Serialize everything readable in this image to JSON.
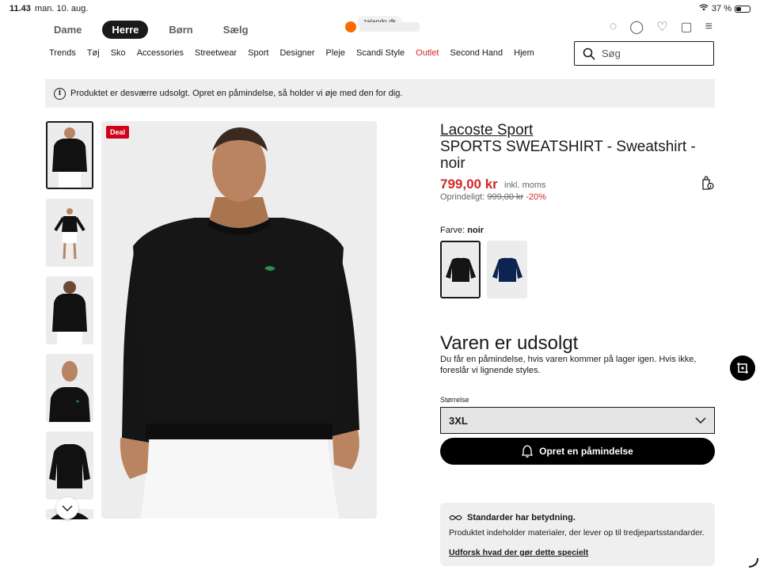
{
  "status": {
    "time": "11.43",
    "date": "man. 10. aug.",
    "battery": "37 %",
    "battery_level": 0.37
  },
  "browser": {
    "url": "zalando.dk"
  },
  "topnav": {
    "tabs": [
      "Dame",
      "Herre",
      "Børn",
      "Sælg"
    ],
    "active_tab": "Herre"
  },
  "catnav": {
    "items": [
      "Trends",
      "Tøj",
      "Sko",
      "Accessories",
      "Streetwear",
      "Sport",
      "Designer",
      "Pleje",
      "Scandi Style",
      "Outlet",
      "Second Hand",
      "Hjem"
    ]
  },
  "search": {
    "placeholder": "Søg"
  },
  "notice": {
    "text": "Produktet er desværre udsolgt. Opret en påmindelse, så holder vi øje med den for dig."
  },
  "product": {
    "badge": "Deal",
    "brand": "Lacoste Sport",
    "name": "SPORTS SWEATSHIRT - Sweatshirt - noir",
    "price": "799,00 kr",
    "price_note": "inkl. moms",
    "original_label": "Oprindeligt:",
    "original_price": "999,00 kr",
    "discount": "-20%",
    "color_label": "Farve:",
    "color_value": "noir"
  },
  "availability": {
    "title": "Varen er udsolgt",
    "desc": "Du får en påmindelse, hvis varen kommer på lager igen. Hvis ikke, foreslår vi lignende styles.",
    "size_label": "Størrelse",
    "size_value": "3XL",
    "remind_button": "Opret en påmindelse"
  },
  "standards": {
    "title": "Standarder har betydning.",
    "body": "Produktet indeholder materialer, der lever op til tredjepartsstandarder.",
    "link": "Udforsk hvad der gør dette specielt"
  },
  "colors": {
    "accent": "#d12828",
    "badge": "#d0021b",
    "black": "#000000",
    "navy": "#0d2452"
  }
}
